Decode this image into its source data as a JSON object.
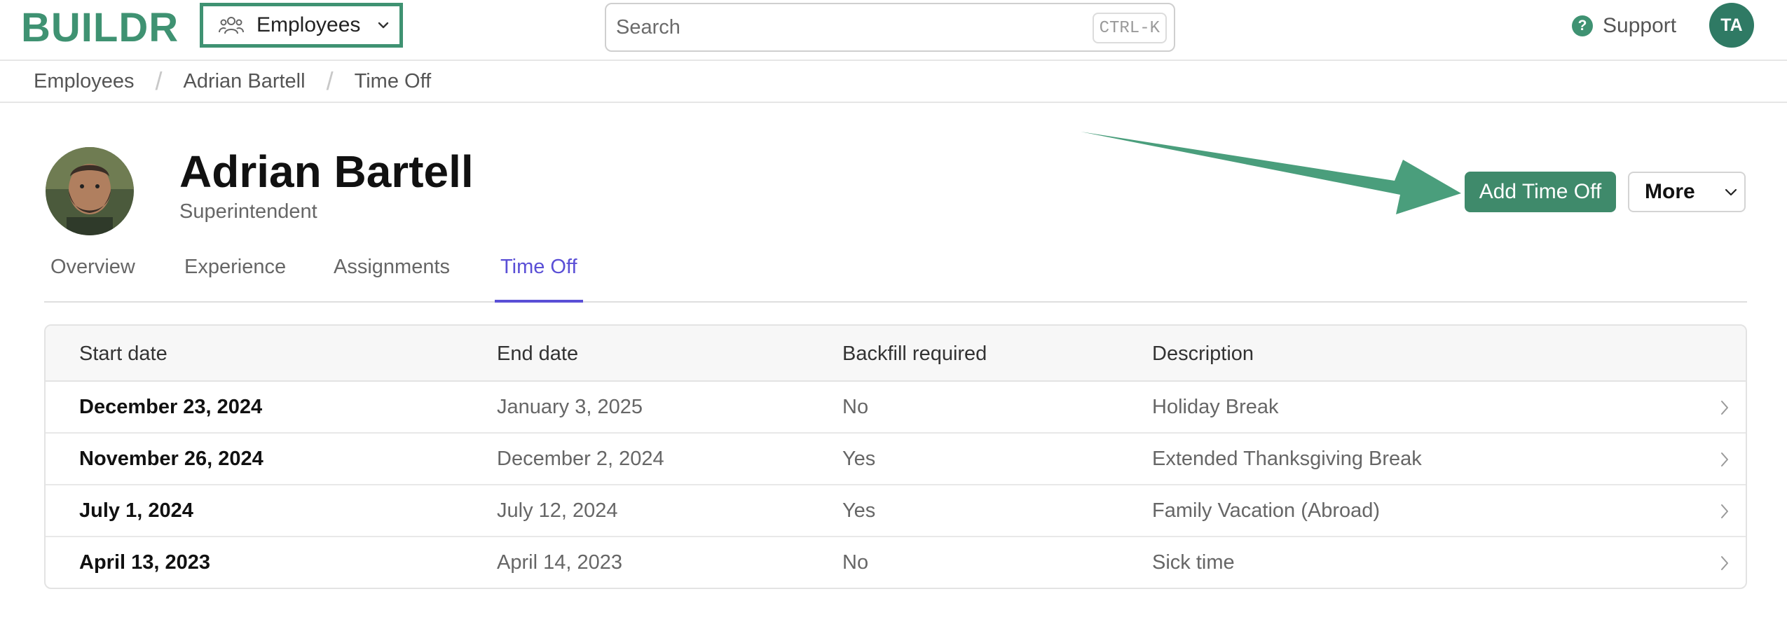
{
  "app": {
    "logo": "BUILDR"
  },
  "header": {
    "module": "Employees",
    "search_placeholder": "Search",
    "search_shortcut": "CTRL-K",
    "support_label": "Support",
    "user_initials": "TA"
  },
  "breadcrumb": [
    "Employees",
    "Adrian Bartell",
    "Time Off"
  ],
  "profile": {
    "name": "Adrian Bartell",
    "role": "Superintendent"
  },
  "actions": {
    "add_time_off": "Add Time Off",
    "more": "More"
  },
  "tabs": [
    {
      "label": "Overview",
      "active": false
    },
    {
      "label": "Experience",
      "active": false
    },
    {
      "label": "Assignments",
      "active": false
    },
    {
      "label": "Time Off",
      "active": true
    }
  ],
  "table": {
    "columns": [
      "Start date",
      "End date",
      "Backfill required",
      "Description"
    ],
    "rows": [
      {
        "start": "December 23, 2024",
        "end": "January 3, 2025",
        "backfill": "No",
        "description": "Holiday Break"
      },
      {
        "start": "November 26, 2024",
        "end": "December 2, 2024",
        "backfill": "Yes",
        "description": "Extended Thanksgiving Break"
      },
      {
        "start": "July 1, 2024",
        "end": "July 12, 2024",
        "backfill": "Yes",
        "description": "Family Vacation (Abroad)"
      },
      {
        "start": "April 13, 2023",
        "end": "April 14, 2023",
        "backfill": "No",
        "description": "Sick time"
      }
    ]
  },
  "colors": {
    "brand": "#3f9272",
    "primary_button": "#3f8a6b",
    "active_tab": "#5a4fd6"
  },
  "icons": {
    "module": "people-icon",
    "support": "help-circle-icon",
    "row_action": "chevron-right-icon"
  }
}
